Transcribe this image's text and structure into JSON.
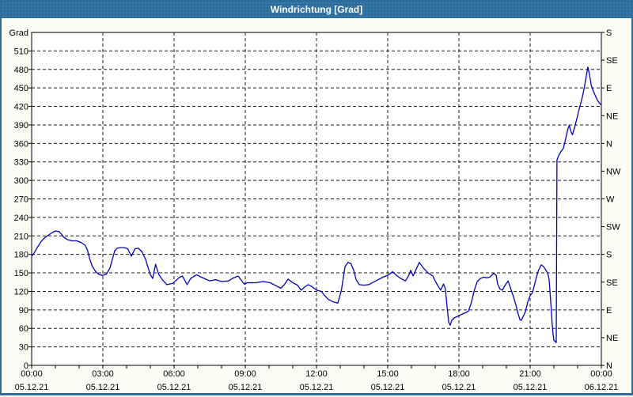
{
  "window": {
    "title": "Windrichtung [Grad]"
  },
  "colors": {
    "titlebar": "#2B6E9E",
    "window_border": "#2B6E9E",
    "background": "#FCFBF4",
    "plot_background": "#FFFFFF",
    "line": "#0000BE",
    "grid": "#1A1A1A",
    "axis": "#000000",
    "text": "#000000",
    "title_text": "#FFFFFF"
  },
  "chart_data": {
    "type": "line",
    "title": "Windrichtung [Grad]",
    "xlabel": "",
    "ylabel": "Grad",
    "ylim": [
      0,
      540
    ],
    "y_step": 30,
    "grid": "dashed",
    "legend_position": "none",
    "y_ticks": [
      {
        "value": 510,
        "label": "510"
      },
      {
        "value": 480,
        "label": "480"
      },
      {
        "value": 450,
        "label": "450"
      },
      {
        "value": 420,
        "label": "420"
      },
      {
        "value": 390,
        "label": "390"
      },
      {
        "value": 360,
        "label": "360"
      },
      {
        "value": 330,
        "label": "330"
      },
      {
        "value": 300,
        "label": "300"
      },
      {
        "value": 270,
        "label": "270"
      },
      {
        "value": 240,
        "label": "240"
      },
      {
        "value": 210,
        "label": "210"
      },
      {
        "value": 180,
        "label": "180"
      },
      {
        "value": 150,
        "label": "150"
      },
      {
        "value": 120,
        "label": "120"
      },
      {
        "value": 90,
        "label": "90"
      },
      {
        "value": 60,
        "label": "60"
      },
      {
        "value": 30,
        "label": "30"
      },
      {
        "value": 0,
        "label": "0"
      }
    ],
    "right_axis_labels": [
      {
        "value": 540,
        "label": "S"
      },
      {
        "value": 495,
        "label": "SE"
      },
      {
        "value": 450,
        "label": "E"
      },
      {
        "value": 405,
        "label": "NE"
      },
      {
        "value": 360,
        "label": "N"
      },
      {
        "value": 315,
        "label": "NW"
      },
      {
        "value": 270,
        "label": "W"
      },
      {
        "value": 225,
        "label": "SW"
      },
      {
        "value": 180,
        "label": "S"
      },
      {
        "value": 135,
        "label": "SE"
      },
      {
        "value": 90,
        "label": "E"
      },
      {
        "value": 45,
        "label": "NE"
      },
      {
        "value": 0,
        "label": "N"
      }
    ],
    "x_ticks": [
      {
        "hour": 0,
        "time": "00:00",
        "date": "05.12.21"
      },
      {
        "hour": 3,
        "time": "03:00",
        "date": "05.12.21"
      },
      {
        "hour": 6,
        "time": "06:00",
        "date": "05.12.21"
      },
      {
        "hour": 9,
        "time": "09:00",
        "date": "05.12.21"
      },
      {
        "hour": 12,
        "time": "12:00",
        "date": "05.12.21"
      },
      {
        "hour": 15,
        "time": "15:00",
        "date": "05.12.21"
      },
      {
        "hour": 18,
        "time": "18:00",
        "date": "05.12.21"
      },
      {
        "hour": 21,
        "time": "21:00",
        "date": "05.12.21"
      },
      {
        "hour": 24,
        "time": "00:00",
        "date": "06.12.21"
      }
    ],
    "x_minor_tick_hours": 1,
    "series": [
      {
        "name": "Windrichtung [Grad]",
        "points": [
          [
            0,
            177
          ],
          [
            0.1,
            182
          ],
          [
            0.25,
            192
          ],
          [
            0.4,
            201
          ],
          [
            0.55,
            207
          ],
          [
            0.7,
            211
          ],
          [
            0.85,
            215
          ],
          [
            1.0,
            218
          ],
          [
            1.15,
            217
          ],
          [
            1.25,
            213
          ],
          [
            1.35,
            208
          ],
          [
            1.5,
            204
          ],
          [
            1.7,
            202
          ],
          [
            1.9,
            202
          ],
          [
            2.1,
            199
          ],
          [
            2.25,
            195
          ],
          [
            2.35,
            187
          ],
          [
            2.45,
            172
          ],
          [
            2.55,
            161
          ],
          [
            2.7,
            152
          ],
          [
            2.85,
            147
          ],
          [
            3.0,
            146
          ],
          [
            3.15,
            148
          ],
          [
            3.3,
            158
          ],
          [
            3.4,
            172
          ],
          [
            3.5,
            186
          ],
          [
            3.6,
            190
          ],
          [
            3.75,
            191
          ],
          [
            3.9,
            191
          ],
          [
            4.05,
            189
          ],
          [
            4.2,
            177
          ],
          [
            4.35,
            189
          ],
          [
            4.5,
            190
          ],
          [
            4.65,
            184
          ],
          [
            4.8,
            172
          ],
          [
            4.9,
            159
          ],
          [
            5.0,
            147
          ],
          [
            5.1,
            141
          ],
          [
            5.22,
            164
          ],
          [
            5.35,
            148
          ],
          [
            5.5,
            139
          ],
          [
            5.7,
            131
          ],
          [
            5.95,
            133
          ],
          [
            6.2,
            142
          ],
          [
            6.35,
            145
          ],
          [
            6.55,
            131
          ],
          [
            6.7,
            141
          ],
          [
            6.95,
            147
          ],
          [
            7.15,
            143
          ],
          [
            7.5,
            137
          ],
          [
            7.75,
            139
          ],
          [
            8.0,
            136
          ],
          [
            8.3,
            137
          ],
          [
            8.45,
            141
          ],
          [
            8.7,
            145
          ],
          [
            8.95,
            132
          ],
          [
            9.1,
            134
          ],
          [
            9.45,
            134
          ],
          [
            9.75,
            136
          ],
          [
            10.05,
            134
          ],
          [
            10.35,
            128
          ],
          [
            10.5,
            125
          ],
          [
            10.65,
            131
          ],
          [
            10.8,
            140
          ],
          [
            11.0,
            134
          ],
          [
            11.2,
            130
          ],
          [
            11.35,
            122
          ],
          [
            11.5,
            127
          ],
          [
            11.65,
            131
          ],
          [
            11.8,
            128
          ],
          [
            12.0,
            122
          ],
          [
            12.2,
            120
          ],
          [
            12.35,
            113
          ],
          [
            12.5,
            107
          ],
          [
            12.7,
            103
          ],
          [
            12.9,
            101
          ],
          [
            13.05,
            122
          ],
          [
            13.2,
            160
          ],
          [
            13.33,
            167
          ],
          [
            13.45,
            165
          ],
          [
            13.57,
            154
          ],
          [
            13.67,
            139
          ],
          [
            13.8,
            131
          ],
          [
            14.0,
            130
          ],
          [
            14.2,
            131
          ],
          [
            14.4,
            135
          ],
          [
            14.6,
            139
          ],
          [
            14.8,
            143
          ],
          [
            15.05,
            147
          ],
          [
            15.2,
            152
          ],
          [
            15.4,
            145
          ],
          [
            15.55,
            141
          ],
          [
            15.75,
            137
          ],
          [
            15.9,
            147
          ],
          [
            15.97,
            154
          ],
          [
            16.07,
            145
          ],
          [
            16.2,
            156
          ],
          [
            16.33,
            167
          ],
          [
            16.5,
            158
          ],
          [
            16.7,
            150
          ],
          [
            16.9,
            145
          ],
          [
            17.0,
            137
          ],
          [
            17.13,
            128
          ],
          [
            17.23,
            122
          ],
          [
            17.35,
            132
          ],
          [
            17.43,
            124
          ],
          [
            17.5,
            95
          ],
          [
            17.57,
            70
          ],
          [
            17.63,
            65
          ],
          [
            17.7,
            73
          ],
          [
            17.8,
            77
          ],
          [
            17.97,
            80
          ],
          [
            18.07,
            82
          ],
          [
            18.3,
            86
          ],
          [
            18.4,
            88
          ],
          [
            18.5,
            99
          ],
          [
            18.57,
            109
          ],
          [
            18.63,
            119
          ],
          [
            18.7,
            128
          ],
          [
            18.77,
            136
          ],
          [
            18.9,
            141
          ],
          [
            19.05,
            143
          ],
          [
            19.15,
            142
          ],
          [
            19.3,
            143
          ],
          [
            19.4,
            147
          ],
          [
            19.47,
            149
          ],
          [
            19.57,
            146
          ],
          [
            19.63,
            132
          ],
          [
            19.73,
            124
          ],
          [
            19.83,
            122
          ],
          [
            19.95,
            130
          ],
          [
            20.07,
            137
          ],
          [
            20.17,
            126
          ],
          [
            20.3,
            111
          ],
          [
            20.4,
            98
          ],
          [
            20.5,
            83
          ],
          [
            20.57,
            74
          ],
          [
            20.63,
            73
          ],
          [
            20.8,
            87
          ],
          [
            20.9,
            103
          ],
          [
            21.0,
            113
          ],
          [
            21.1,
            118
          ],
          [
            21.25,
            141
          ],
          [
            21.35,
            154
          ],
          [
            21.47,
            163
          ],
          [
            21.57,
            160
          ],
          [
            21.67,
            154
          ],
          [
            21.75,
            148
          ],
          [
            21.8,
            139
          ],
          [
            21.84,
            118
          ],
          [
            21.88,
            96
          ],
          [
            21.92,
            72
          ],
          [
            21.96,
            52
          ],
          [
            22.0,
            41
          ],
          [
            22.1,
            37
          ],
          [
            22.13,
            333
          ],
          [
            22.2,
            340
          ],
          [
            22.3,
            347
          ],
          [
            22.4,
            352
          ],
          [
            22.5,
            368
          ],
          [
            22.6,
            385
          ],
          [
            22.65,
            389
          ],
          [
            22.72,
            379
          ],
          [
            22.78,
            374
          ],
          [
            22.88,
            387
          ],
          [
            22.98,
            402
          ],
          [
            23.08,
            418
          ],
          [
            23.18,
            432
          ],
          [
            23.28,
            450
          ],
          [
            23.36,
            468
          ],
          [
            23.43,
            484
          ],
          [
            23.5,
            472
          ],
          [
            23.57,
            455
          ],
          [
            23.65,
            446
          ],
          [
            23.75,
            437
          ],
          [
            23.85,
            429
          ],
          [
            23.97,
            423
          ]
        ]
      }
    ]
  }
}
